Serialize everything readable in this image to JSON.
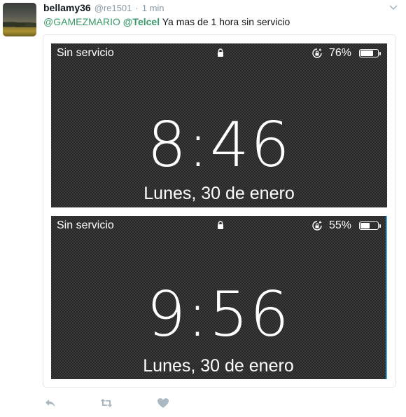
{
  "tweet": {
    "fullname": "bellamy36",
    "username": "@re1501",
    "separator": "·",
    "time": "1 min",
    "mention1": "@GAMEZMARIO",
    "mention2": "@Telcel",
    "text": "Ya mas de 1 hora sin servicio"
  },
  "screenshots": [
    {
      "carrier": "Sin servicio",
      "battery_label": "76%",
      "battery_level": 0.76,
      "time": "8:46",
      "date": "Lunes, 30 de enero"
    },
    {
      "carrier": "Sin servicio",
      "battery_label": "55%",
      "battery_level": 0.55,
      "time": "9:56",
      "date": "Lunes, 30 de enero"
    }
  ],
  "icons": {
    "caret": "chevron-down-icon",
    "reply": "reply-icon",
    "retweet": "retweet-icon",
    "like": "heart-icon",
    "lock": "lock-icon",
    "rotation": "rotation-lock-icon",
    "battery": "battery-icon"
  },
  "colors": {
    "mention": "#3a9a6b",
    "action_icon": "#aab8c2",
    "secondary_text": "#8899a6",
    "lockscreen_bg": "#3a3a3a"
  }
}
